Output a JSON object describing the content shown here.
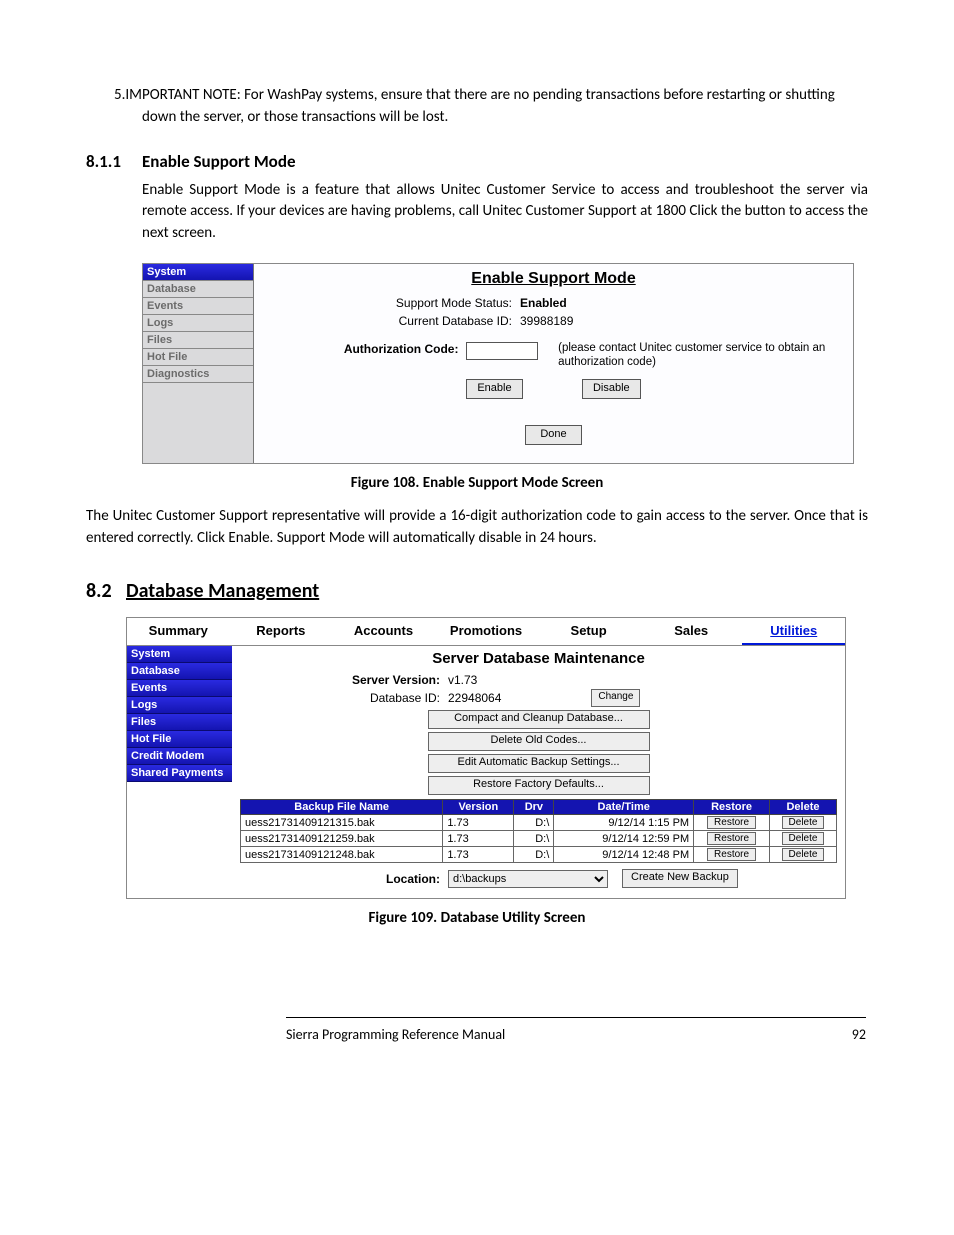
{
  "list_item": {
    "number": "5.",
    "text": "IMPORTANT NOTE: For WashPay systems, ensure that there are no pending transactions before restarting or shutting down the server, or those transactions will be lost."
  },
  "section_811": {
    "num": "8.1.1",
    "title": "Enable Support Mode",
    "body": "Enable Support Mode is a feature that allows Unitec Customer Service to access and troubleshoot the server via remote access. If your devices are having problems, call Unitec Customer Support at 1800 Click the button to access the next screen."
  },
  "fig108": {
    "sidebar": [
      "System",
      "Database",
      "Events",
      "Logs",
      "Files",
      "Hot File",
      "Diagnostics"
    ],
    "title": "Enable Support Mode",
    "status_label": "Support Mode Status:",
    "status_value": "Enabled",
    "db_label": "Current Database ID:",
    "db_value": "39988189",
    "auth_label": "Authorization Code:",
    "auth_note": "(please contact Unitec customer service to obtain an authorization code)",
    "btn_enable": "Enable",
    "btn_disable": "Disable",
    "btn_done": "Done",
    "caption": "Figure 108. Enable Support Mode Screen"
  },
  "after108": "The Unitec Customer Support representative will provide a 16-digit authorization code to gain access to the server. Once that is entered correctly. Click Enable. Support Mode will automatically disable in 24 hours.",
  "section_82": {
    "num": "8.2",
    "title": "Database Management"
  },
  "fig109": {
    "tabs": [
      "Summary",
      "Reports",
      "Accounts",
      "Promotions",
      "Setup",
      "Sales",
      "Utilities"
    ],
    "sidebar": [
      "System",
      "Database",
      "Events",
      "Logs",
      "Files",
      "Hot File",
      "Credit Modem",
      "Shared Payments"
    ],
    "title": "Server Database Maintenance",
    "ver_label": "Server Version:",
    "ver_value": "v1.73",
    "db_label": "Database ID:",
    "db_value": "22948064",
    "btn_change": "Change",
    "btns": [
      "Compact and Cleanup Database...",
      "Delete Old Codes...",
      "Edit Automatic Backup Settings...",
      "Restore Factory Defaults..."
    ],
    "cols": [
      "Backup File Name",
      "Version",
      "Drv",
      "Date/Time",
      "Restore",
      "Delete"
    ],
    "rows": [
      {
        "name": "uess21731409121315.bak",
        "ver": "1.73",
        "drv": "D:\\",
        "dt": "9/12/14 1:15 PM"
      },
      {
        "name": "uess21731409121259.bak",
        "ver": "1.73",
        "drv": "D:\\",
        "dt": "9/12/14 12:59 PM"
      },
      {
        "name": "uess21731409121248.bak",
        "ver": "1.73",
        "drv": "D:\\",
        "dt": "9/12/14 12:48 PM"
      }
    ],
    "btn_restore": "Restore",
    "btn_delete": "Delete",
    "loc_label": "Location:",
    "loc_value": "d:\\backups",
    "btn_create": "Create New Backup",
    "caption": "Figure 109. Database Utility Screen"
  },
  "footer": {
    "title": "Sierra Programming Reference Manual",
    "page": "92"
  }
}
